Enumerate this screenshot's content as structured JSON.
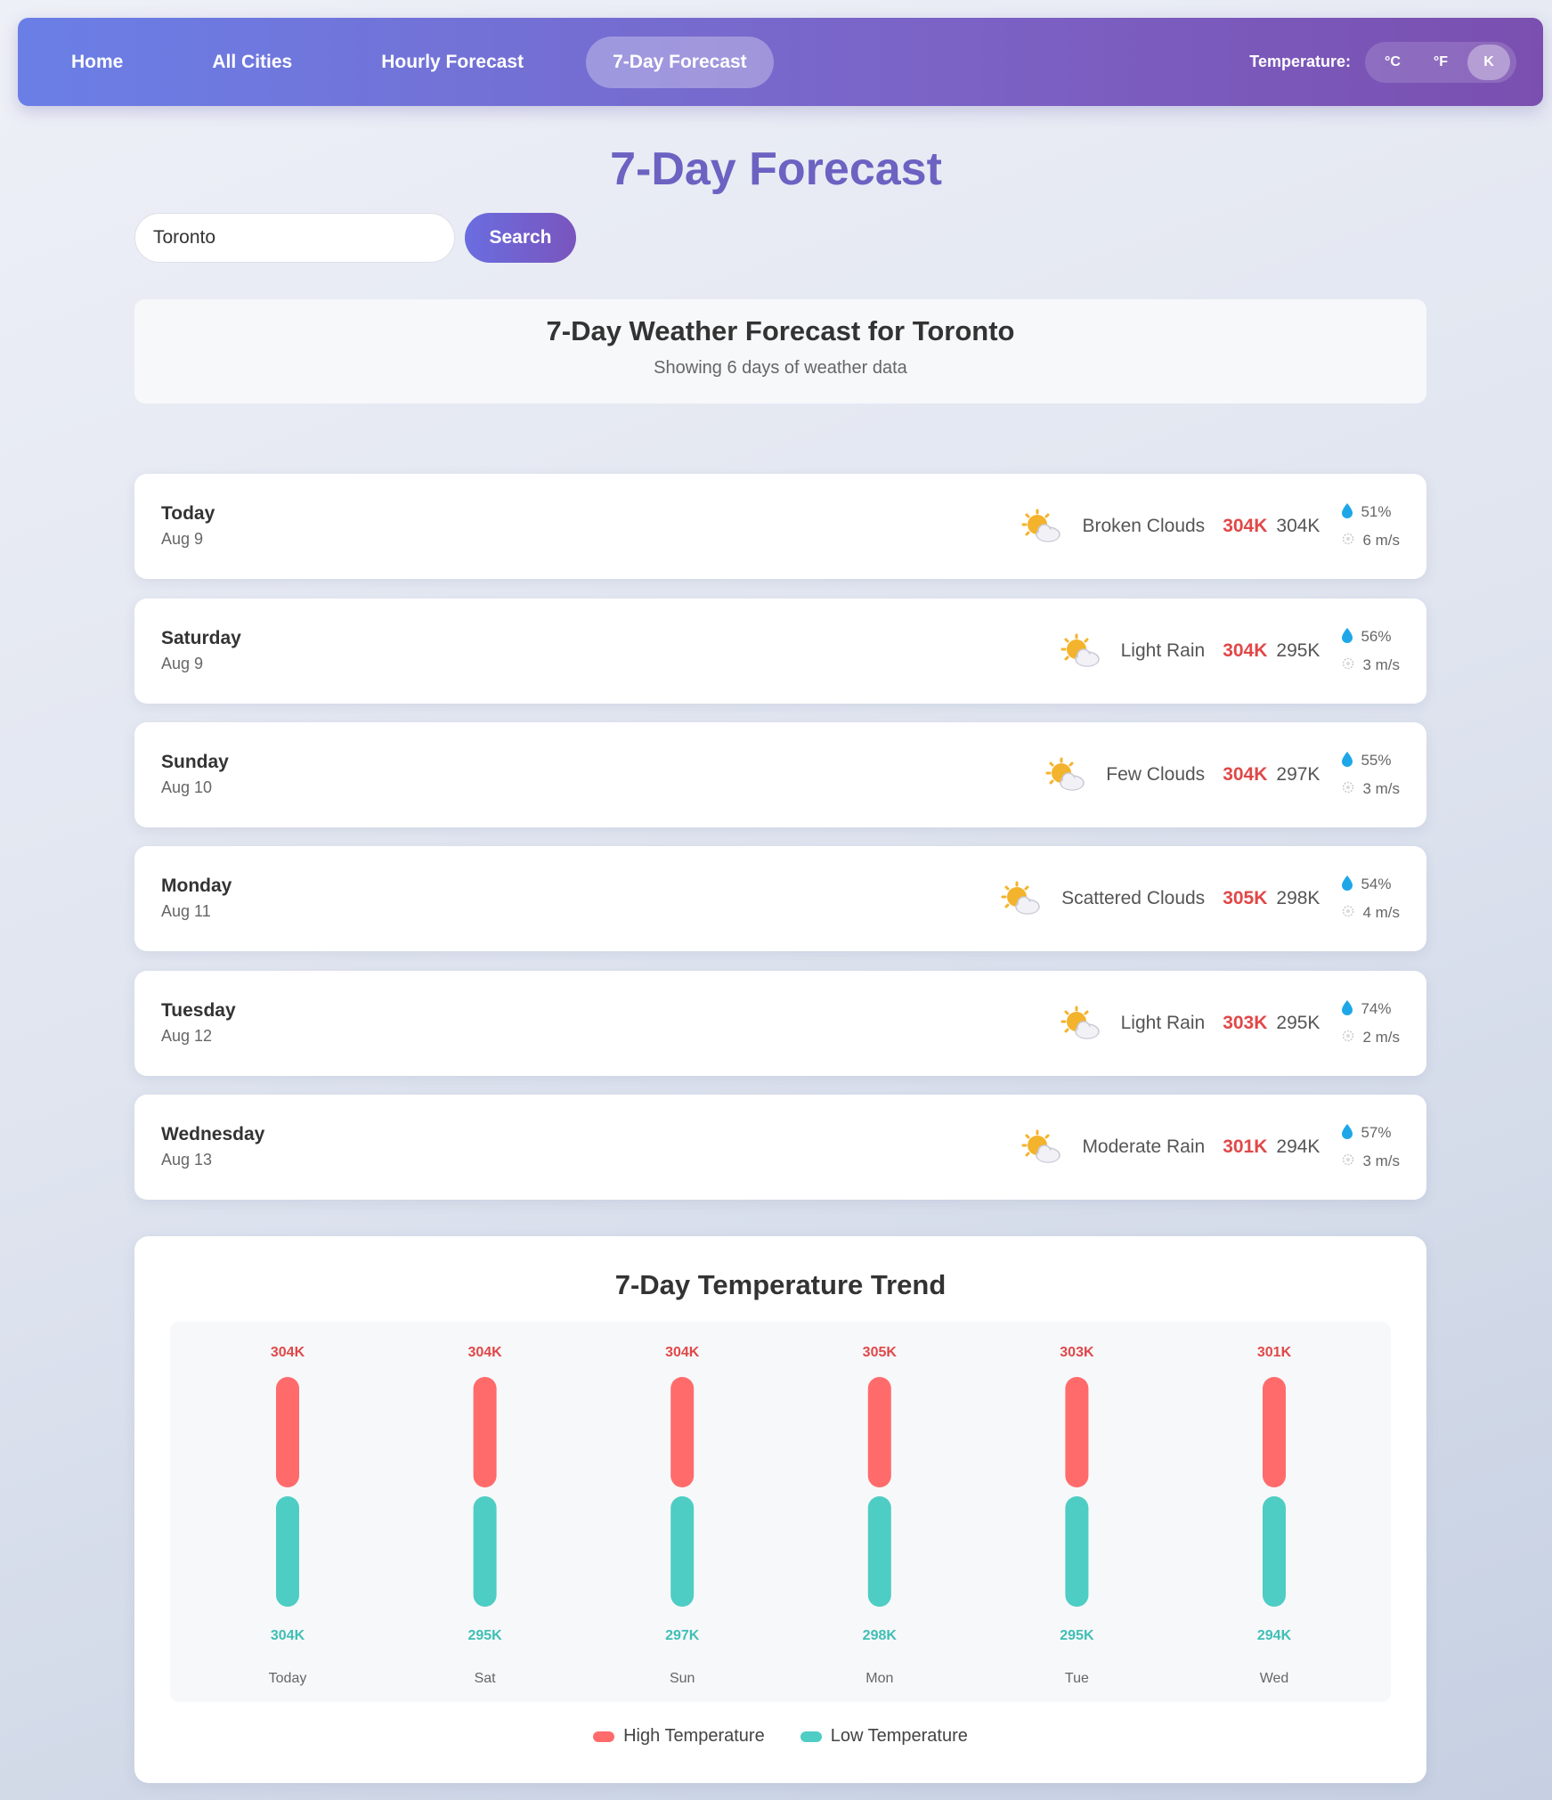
{
  "nav": {
    "links": [
      {
        "label": "Home",
        "active": false
      },
      {
        "label": "All Cities",
        "active": false
      },
      {
        "label": "Hourly Forecast",
        "active": false
      },
      {
        "label": "7-Day Forecast",
        "active": true
      }
    ],
    "temperature_label": "Temperature:",
    "units": [
      {
        "label": "°C",
        "active": false
      },
      {
        "label": "°F",
        "active": false
      },
      {
        "label": "K",
        "active": true
      }
    ]
  },
  "page_title": "7-Day Forecast",
  "search": {
    "value": "Toronto",
    "button": "Search"
  },
  "header": {
    "title": "7-Day Weather Forecast for Toronto",
    "subtitle": "Showing 6 days of weather data"
  },
  "days": [
    {
      "name": "Today",
      "date": "Aug 9",
      "icon": "partly-cloudy-icon",
      "desc": "Broken Clouds",
      "hi": "304K",
      "lo": "304K",
      "humidity": "51%",
      "wind": "6 m/s"
    },
    {
      "name": "Saturday",
      "date": "Aug 9",
      "icon": "partly-cloudy-icon",
      "desc": "Light Rain",
      "hi": "304K",
      "lo": "295K",
      "humidity": "56%",
      "wind": "3 m/s"
    },
    {
      "name": "Sunday",
      "date": "Aug 10",
      "icon": "partly-cloudy-icon",
      "desc": "Few Clouds",
      "hi": "304K",
      "lo": "297K",
      "humidity": "55%",
      "wind": "3 m/s"
    },
    {
      "name": "Monday",
      "date": "Aug 11",
      "icon": "partly-cloudy-icon",
      "desc": "Scattered Clouds",
      "hi": "305K",
      "lo": "298K",
      "humidity": "54%",
      "wind": "4 m/s"
    },
    {
      "name": "Tuesday",
      "date": "Aug 12",
      "icon": "partly-cloudy-icon",
      "desc": "Light Rain",
      "hi": "303K",
      "lo": "295K",
      "humidity": "74%",
      "wind": "2 m/s"
    },
    {
      "name": "Wednesday",
      "date": "Aug 13",
      "icon": "partly-cloudy-icon",
      "desc": "Moderate Rain",
      "hi": "301K",
      "lo": "294K",
      "humidity": "57%",
      "wind": "3 m/s"
    }
  ],
  "colors": {
    "high": "#ff6b6b",
    "low": "#4ecdc4",
    "high_text": "#e04848",
    "low_text": "#3fbfb5",
    "accent": "#6b62c2"
  },
  "chart_data": {
    "type": "bar",
    "title": "7-Day Temperature Trend",
    "categories": [
      "Today",
      "Sat",
      "Sun",
      "Mon",
      "Tue",
      "Wed"
    ],
    "series": [
      {
        "name": "High Temperature",
        "values": [
          304,
          304,
          304,
          305,
          303,
          301
        ],
        "labels": [
          "304K",
          "304K",
          "304K",
          "305K",
          "303K",
          "301K"
        ]
      },
      {
        "name": "Low Temperature",
        "values": [
          304,
          295,
          297,
          298,
          295,
          294
        ],
        "labels": [
          "304K",
          "295K",
          "297K",
          "298K",
          "295K",
          "294K"
        ]
      }
    ]
  }
}
